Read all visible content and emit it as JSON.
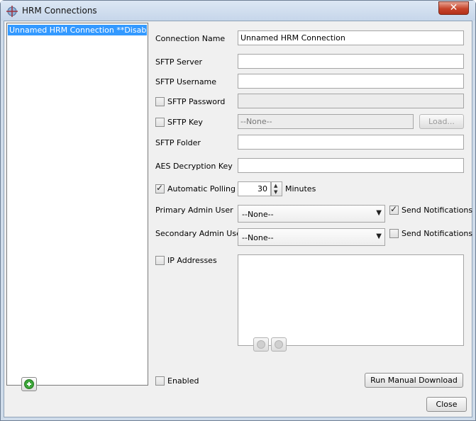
{
  "window": {
    "title": "HRM Connections",
    "close_glyph": "✕"
  },
  "list": {
    "items": [
      {
        "label": "Unnamed HRM Connection **Disabled**",
        "selected": true
      }
    ],
    "add_icon": "add-circle-icon"
  },
  "form": {
    "connection_name": {
      "label": "Connection Name",
      "value": "Unnamed HRM Connection"
    },
    "sftp_server": {
      "label": "SFTP Server",
      "value": ""
    },
    "sftp_username": {
      "label": "SFTP Username",
      "value": ""
    },
    "sftp_password": {
      "label": "SFTP Password",
      "checked": false,
      "value": ""
    },
    "sftp_key": {
      "label": "SFTP Key",
      "checked": false,
      "value": "--None--",
      "load_label": "Load..."
    },
    "sftp_folder": {
      "label": "SFTP Folder",
      "value": ""
    },
    "aes_key": {
      "label": "AES Decryption Key",
      "value": ""
    },
    "polling": {
      "label": "Automatic Polling",
      "checked": true,
      "value": "30",
      "unit": "Minutes"
    },
    "primary_admin": {
      "label": "Primary Admin User",
      "value": "--None--",
      "notify_label": "Send Notifications",
      "notify_checked": true
    },
    "secondary_admin": {
      "label": "Secondary Admin User",
      "value": "--None--",
      "notify_label": "Send Notifications",
      "notify_checked": false
    },
    "ip_addresses": {
      "label": "IP Addresses",
      "checked": false
    },
    "enabled": {
      "label": "Enabled",
      "checked": false
    },
    "run_download_label": "Run Manual Download"
  },
  "footer": {
    "close_label": "Close"
  }
}
